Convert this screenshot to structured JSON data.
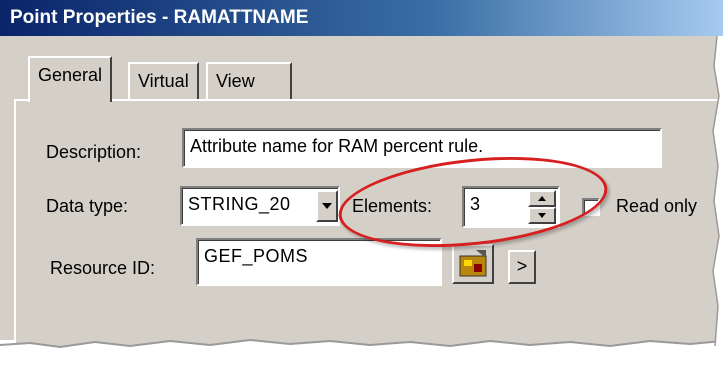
{
  "window": {
    "title": "Point Properties - RAMATTNAME"
  },
  "tabs": [
    {
      "label": "General",
      "active": true
    },
    {
      "label": "Virtual",
      "active": false
    },
    {
      "label": "View",
      "active": false
    }
  ],
  "form": {
    "description_label": "Description:",
    "description_value": "Attribute name for RAM percent rule.",
    "data_type_label": "Data type:",
    "data_type_value": "STRING_20",
    "elements_label": "Elements:",
    "elements_value": "3",
    "read_only_label": "Read only",
    "read_only_checked": false,
    "resource_id_label": "Resource ID:",
    "resource_id_value": "GEF_POMS",
    "next_button_label": ">"
  },
  "colors": {
    "dialog": "#d4d0c8",
    "title_start": "#0a246a",
    "highlight": "#d62020"
  },
  "icons": [
    "dropdown-arrow-icon",
    "spin-up-icon",
    "spin-down-icon",
    "resource-browse-icon"
  ]
}
